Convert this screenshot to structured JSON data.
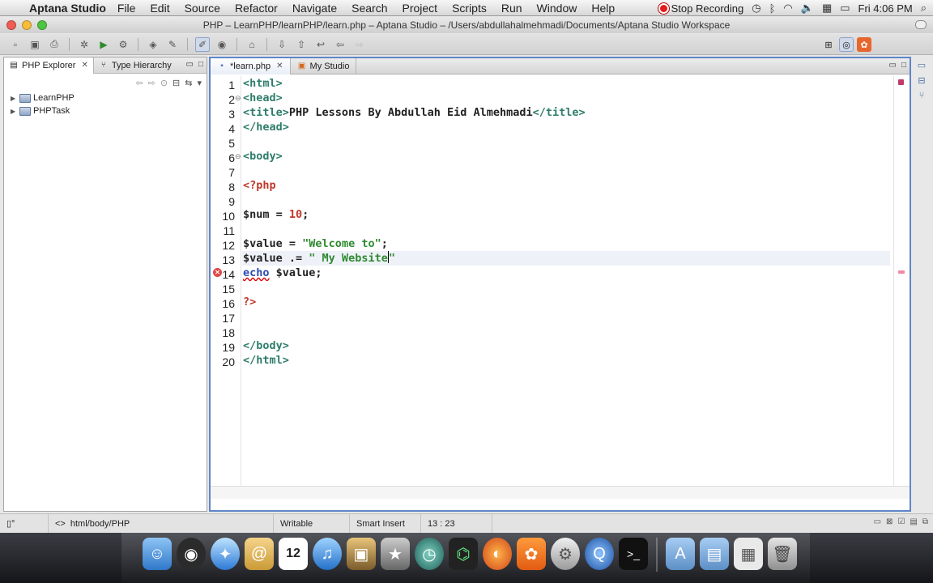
{
  "menubar": {
    "app_name": "Aptana Studio",
    "items": [
      "File",
      "Edit",
      "Source",
      "Refactor",
      "Navigate",
      "Search",
      "Project",
      "Scripts",
      "Run",
      "Window",
      "Help"
    ],
    "recording_label": "Stop Recording",
    "clock": "Fri 4:06 PM"
  },
  "window": {
    "title": "PHP – LearnPHP/learnPHP/learn.php – Aptana Studio – /Users/abdullahalmehmadi/Documents/Aptana Studio Workspace"
  },
  "left_panel": {
    "tabs": [
      "PHP Explorer",
      "Type Hierarchy"
    ],
    "projects": [
      "LearnPHP",
      "PHPTask"
    ]
  },
  "editor": {
    "tabs": [
      "*learn.php",
      "My Studio"
    ],
    "line_numbers": [
      "1",
      "2",
      "3",
      "4",
      "5",
      "6",
      "7",
      "8",
      "9",
      "10",
      "11",
      "12",
      "13",
      "14",
      "15",
      "16",
      "17",
      "18",
      "19",
      "20"
    ],
    "lines": {
      "l1": "<html>",
      "l2": "<head>",
      "l3_open": "<title>",
      "l3_text": "PHP Lessons By Abdullah Eid Almehmadi",
      "l3_close": "</title>",
      "l4": "</head>",
      "l6": "<body>",
      "l8": "<?php",
      "l10_var": "$num",
      "l10_op": " = ",
      "l10_num": "10",
      "l10_end": ";",
      "l12_var": "$value",
      "l12_op": " = ",
      "l12_str": "\"Welcome to\"",
      "l12_end": ";",
      "l13_var": "$value",
      "l13_op": " .= ",
      "l13_str": "\" My Website",
      "l13_str_end": "\"",
      "l14_kw": "echo",
      "l14_rest": " $value;",
      "l16": "?>",
      "l19": "</body>",
      "l20": "</html>"
    }
  },
  "statusbar": {
    "breadcrumb": "html/body/PHP",
    "mode": "Writable",
    "insert_mode": "Smart Insert",
    "position": "13 : 23"
  }
}
